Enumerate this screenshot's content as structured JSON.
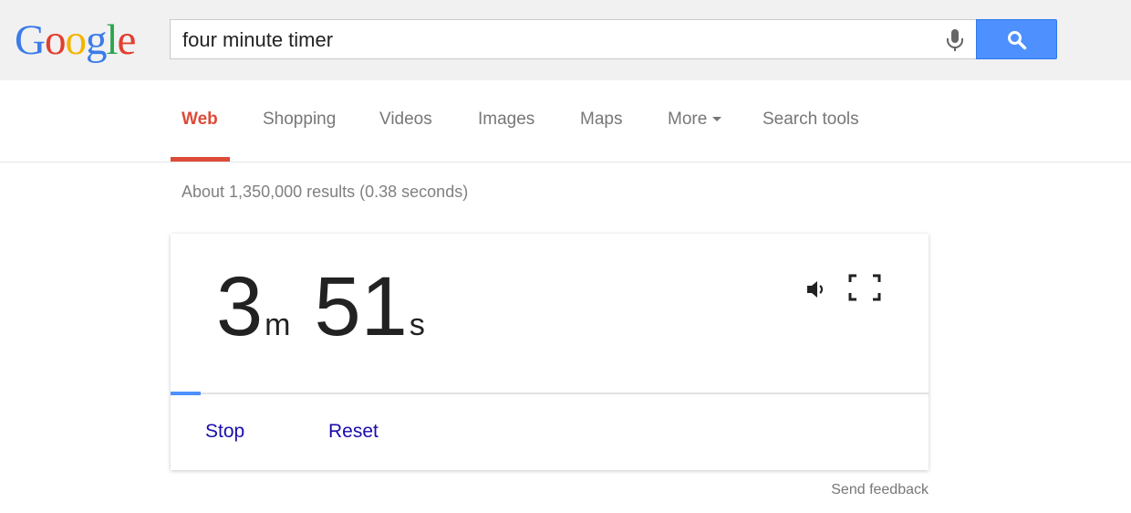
{
  "logo": {
    "letters": [
      "G",
      "o",
      "o",
      "g",
      "l",
      "e"
    ],
    "colors": [
      "#3b7bea",
      "#e23e2f",
      "#f4b400",
      "#3b7bea",
      "#2da44e",
      "#e23e2f"
    ]
  },
  "search": {
    "query": "four minute timer",
    "mic_icon": "microphone-icon",
    "button_icon": "search-icon"
  },
  "nav": {
    "tabs": [
      "Web",
      "Shopping",
      "Videos",
      "Images",
      "Maps",
      "More",
      "Search tools"
    ],
    "active": "Web",
    "accent": "#dd4b39"
  },
  "results": {
    "stats": "About 1,350,000 results (0.38 seconds)"
  },
  "timer": {
    "minutes": "3",
    "minutes_unit": "m",
    "seconds": "51",
    "seconds_unit": "s",
    "progress_fraction": 0.04,
    "progress_color": "#4d90fe",
    "sound_icon": "speaker-icon",
    "fullscreen_icon": "fullscreen-icon",
    "stop_label": "Stop",
    "reset_label": "Reset"
  },
  "feedback": {
    "label": "Send feedback"
  }
}
